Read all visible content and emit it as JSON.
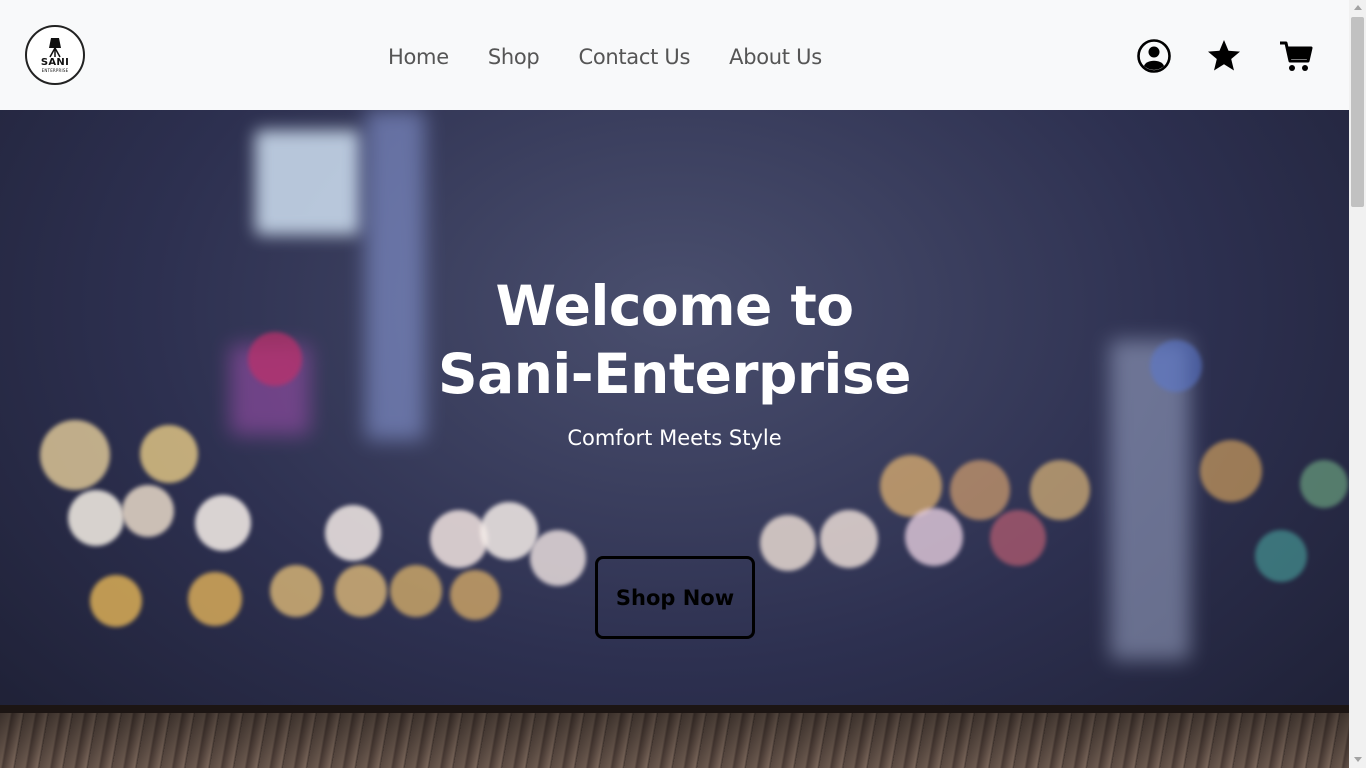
{
  "brand": {
    "logo_text": "SANI",
    "logo_subtext": "ENTERPRISE"
  },
  "nav": {
    "items": [
      {
        "label": "Home"
      },
      {
        "label": "Shop"
      },
      {
        "label": "Contact Us"
      },
      {
        "label": "About Us"
      }
    ]
  },
  "header_icons": [
    "user-circle-icon",
    "star-icon",
    "cart-icon"
  ],
  "hero": {
    "title": "Welcome to Sani-Enterprise",
    "subtitle": "Comfort Meets Style",
    "cta_label": "Shop Now"
  },
  "colors": {
    "header_bg": "#f8f9fa",
    "nav_text": "#555555",
    "hero_text": "#ffffff",
    "button_border": "#000000"
  }
}
